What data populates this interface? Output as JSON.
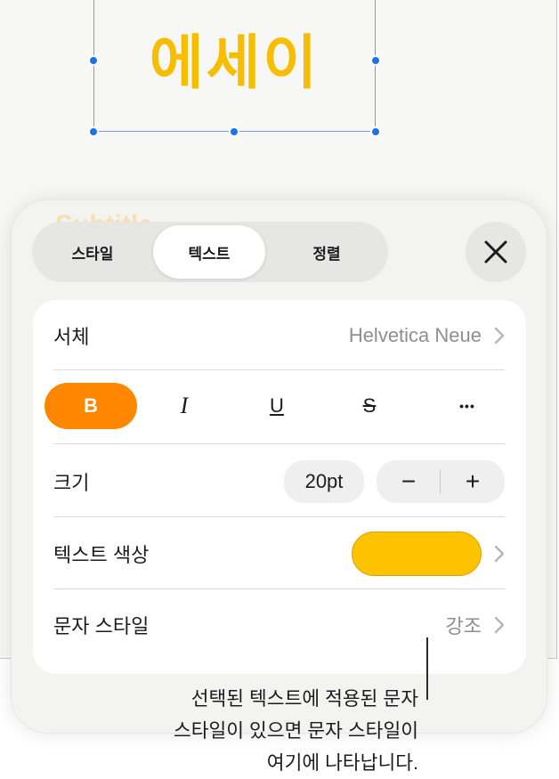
{
  "document": {
    "title_text": "에세이",
    "title_color": "#f7bd00",
    "ghost_text": "Subtitle"
  },
  "tabs": {
    "items": [
      {
        "label": "스타일",
        "active": false
      },
      {
        "label": "텍스트",
        "active": true
      },
      {
        "label": "정렬",
        "active": false
      }
    ]
  },
  "close_button": {
    "icon": "close-icon"
  },
  "font_row": {
    "label": "서체",
    "value": "Helvetica Neue"
  },
  "format_buttons": {
    "bold": "B",
    "italic": "I",
    "underline": "U",
    "strikethrough": "S",
    "more": "•••"
  },
  "size_row": {
    "label": "크기",
    "value": "20pt",
    "decrement": "−",
    "increment": "+"
  },
  "color_row": {
    "label": "텍스트 색상",
    "color": "#fdc200"
  },
  "char_style_row": {
    "label": "문자 스타일",
    "value": "강조"
  },
  "callout": {
    "lines": [
      "선택된 텍스트에 적용된 문자",
      "스타일이 있으면 문자 스타일이",
      "여기에 나타납니다."
    ]
  },
  "colors": {
    "accent": "#ff8700",
    "selection": "#1a73e8"
  }
}
